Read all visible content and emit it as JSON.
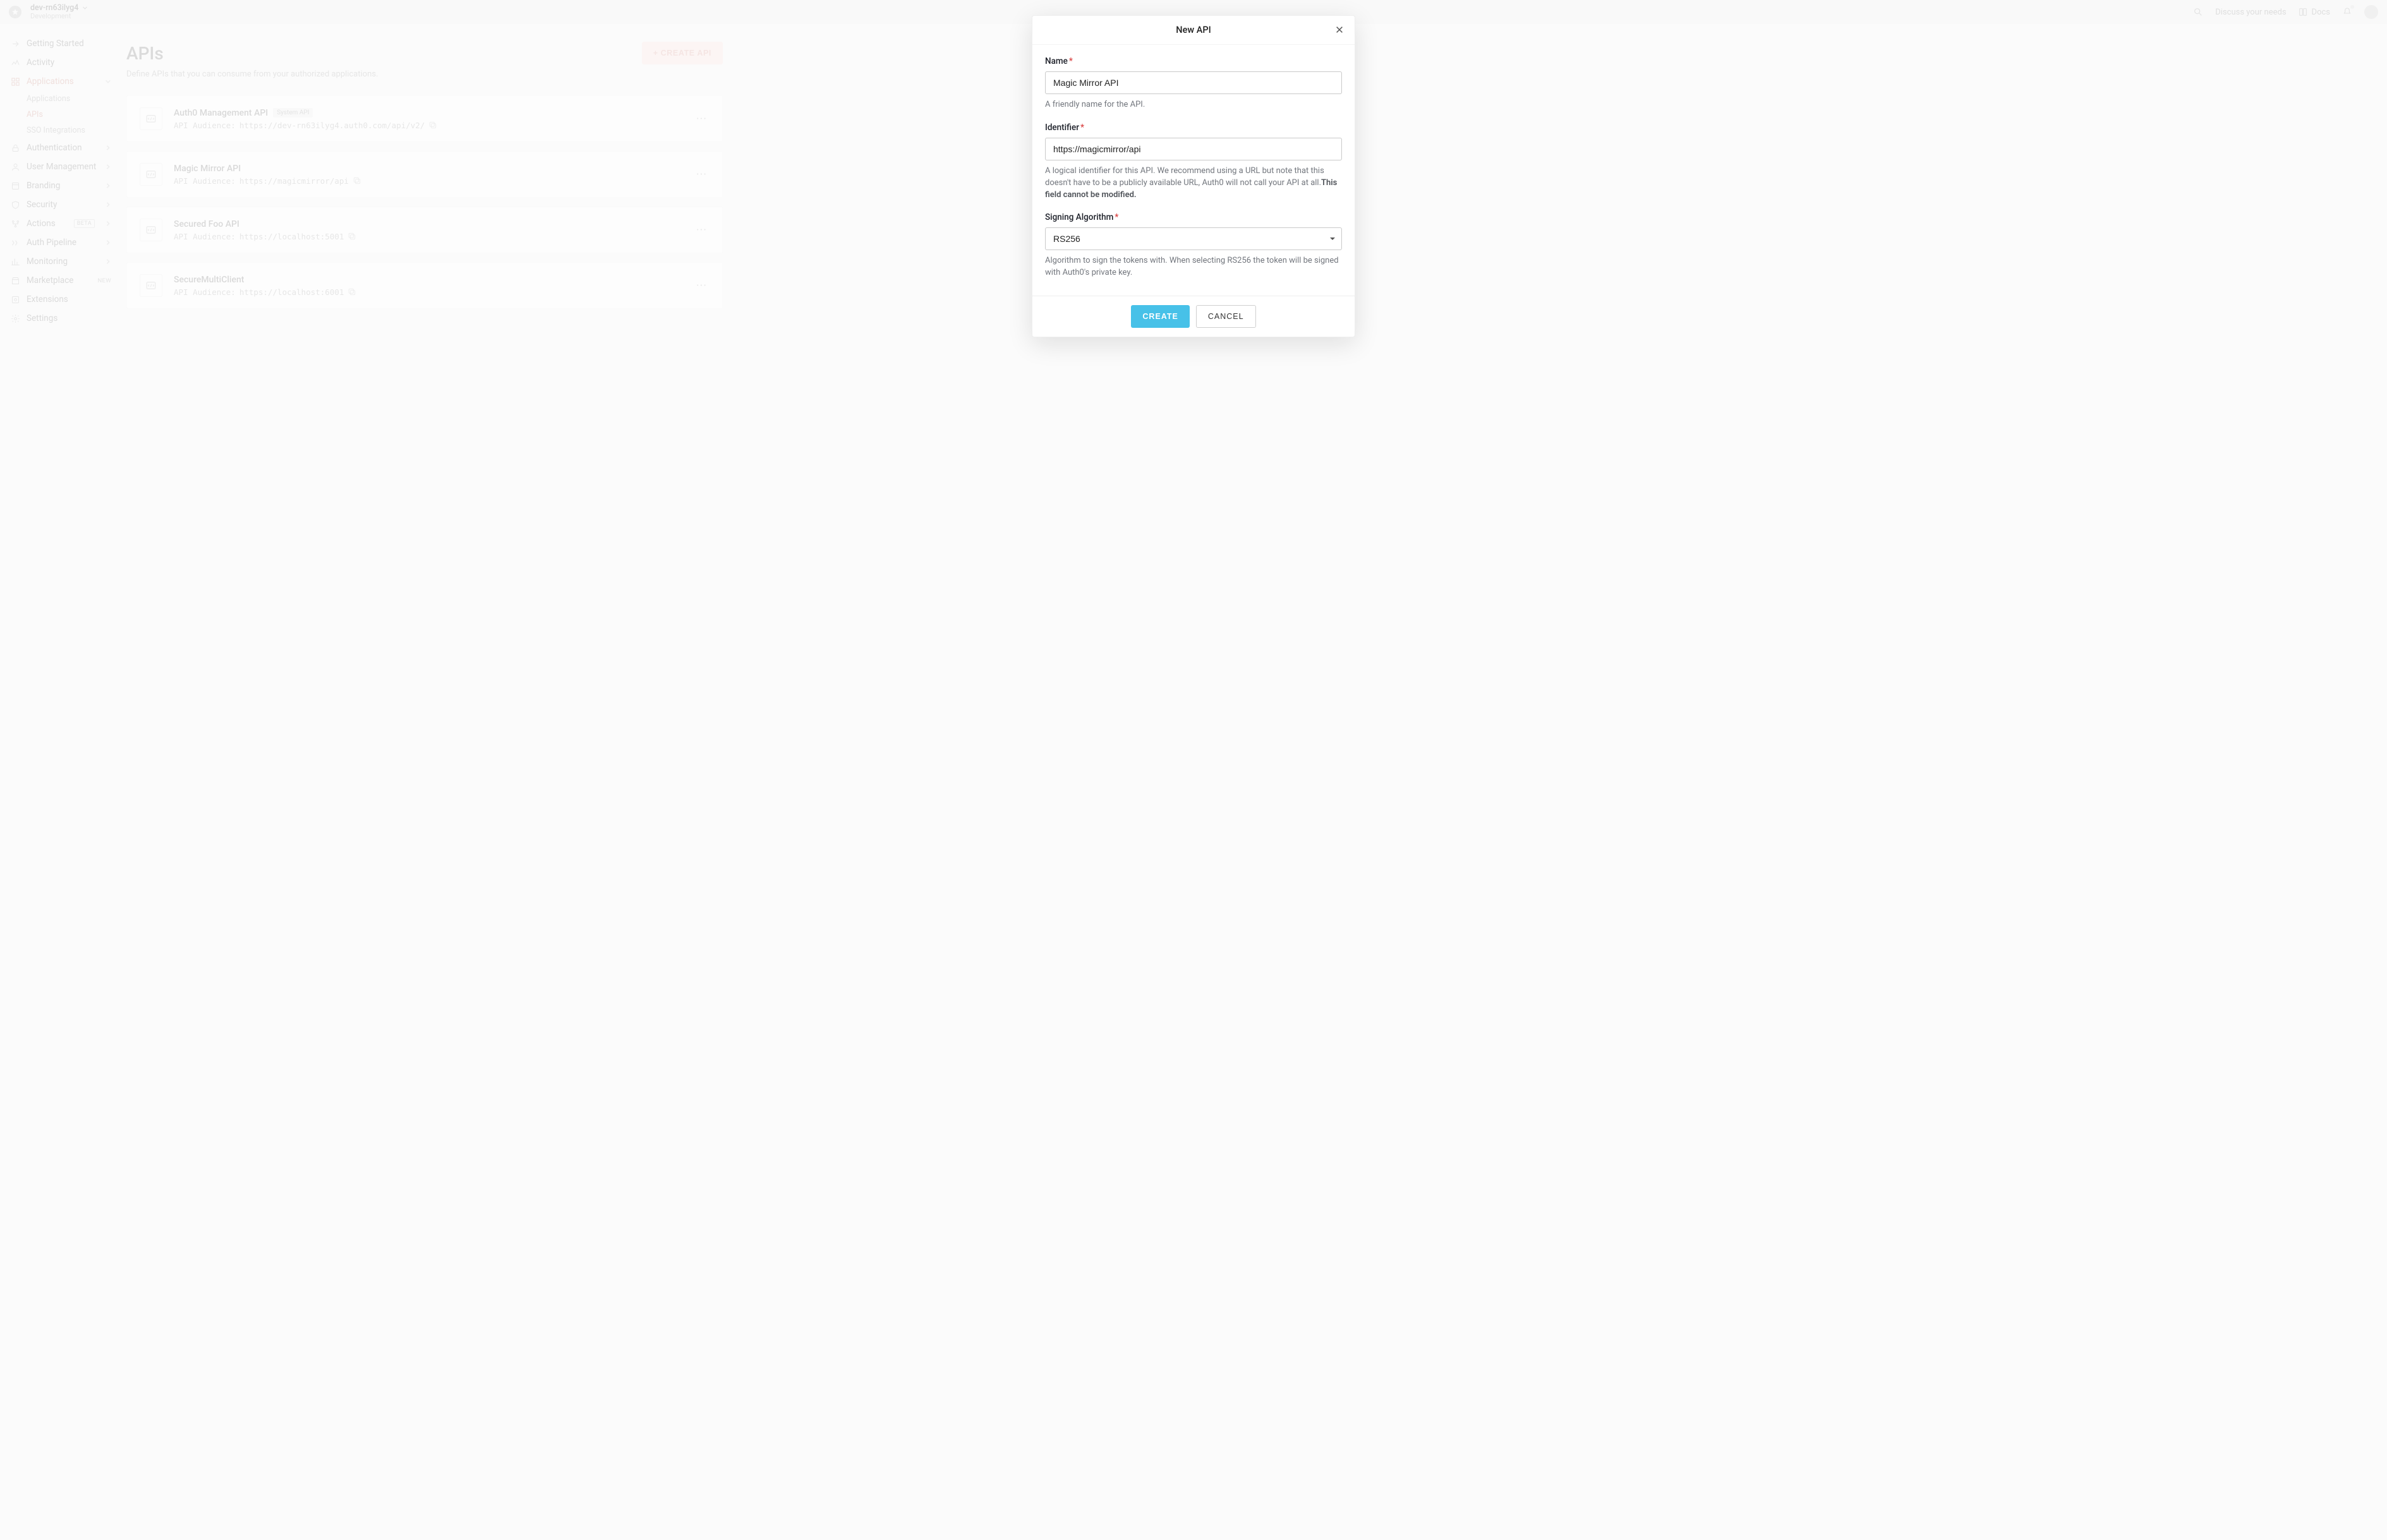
{
  "topbar": {
    "tenant_name": "dev-rn63ilyg4",
    "tenant_env": "Development",
    "discuss_label": "Discuss your needs",
    "docs_label": "Docs"
  },
  "sidebar": {
    "items": [
      {
        "label": "Getting Started"
      },
      {
        "label": "Activity"
      },
      {
        "label": "Applications"
      },
      {
        "label": "Authentication"
      },
      {
        "label": "User Management"
      },
      {
        "label": "Branding"
      },
      {
        "label": "Security"
      },
      {
        "label": "Actions",
        "badge": "BETA"
      },
      {
        "label": "Auth Pipeline"
      },
      {
        "label": "Monitoring"
      },
      {
        "label": "Marketplace",
        "badge": "NEW"
      },
      {
        "label": "Extensions"
      },
      {
        "label": "Settings"
      }
    ],
    "sub_applications": [
      {
        "label": "Applications"
      },
      {
        "label": "APIs"
      },
      {
        "label": "SSO Integrations"
      }
    ]
  },
  "page": {
    "title": "APIs",
    "description_prefix": "Define APIs that you can consume from your authorized applications.",
    "create_button": "+ CREATE API"
  },
  "apis": [
    {
      "name": "Auth0 Management API",
      "system": "System API",
      "audience_label": "API Audience:",
      "audience": "https://dev-rn63ilyg4.auth0.com/api/v2/"
    },
    {
      "name": "Magic Mirror API",
      "audience_label": "API Audience:",
      "audience": "https://magicmirror/api"
    },
    {
      "name": "Secured Foo API",
      "audience_label": "API Audience:",
      "audience": "https://localhost:5001"
    },
    {
      "name": "SecureMultiClient",
      "audience_label": "API Audience:",
      "audience": "https://localhost:6001"
    }
  ],
  "modal": {
    "title": "New API",
    "name_label": "Name",
    "name_value": "Magic Mirror API",
    "name_help": "A friendly name for the API.",
    "identifier_label": "Identifier",
    "identifier_value": "https://magicmirror/api",
    "identifier_help": "A logical identifier for this API. We recommend using a URL but note that this doesn't have to be a publicly available URL, Auth0 will not call your API at all.",
    "identifier_help_bold": "This field cannot be modified.",
    "algo_label": "Signing Algorithm",
    "algo_value": "RS256",
    "algo_help": "Algorithm to sign the tokens with. When selecting RS256 the token will be signed with Auth0's private key.",
    "create_label": "CREATE",
    "cancel_label": "CANCEL"
  }
}
